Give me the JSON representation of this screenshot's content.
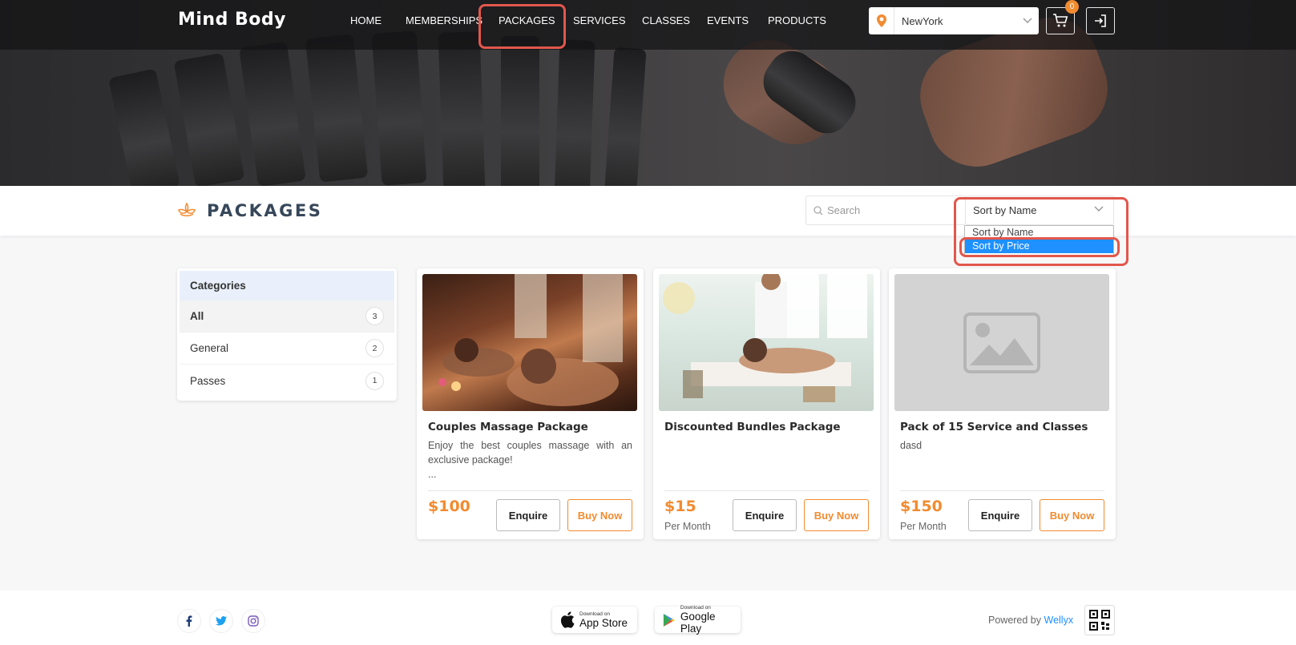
{
  "header": {
    "logo": "Mind Body",
    "nav": [
      {
        "label": "HOME"
      },
      {
        "label": "MEMBERSHIPS"
      },
      {
        "label": "PACKAGES"
      },
      {
        "label": "SERVICES"
      },
      {
        "label": "CLASSES"
      },
      {
        "label": "EVENTS"
      },
      {
        "label": "PRODUCTS"
      }
    ],
    "active_nav": "PACKAGES",
    "location": "NewYork",
    "cart_count": "0"
  },
  "page": {
    "title": "PACKAGES",
    "search_placeholder": "Search",
    "sort_selected": "Sort by Name",
    "sort_options": [
      "Sort by Name",
      "Sort by Price"
    ],
    "sort_highlighted": "Sort by Price"
  },
  "categories": {
    "heading": "Categories",
    "items": [
      {
        "label": "All",
        "count": "3",
        "active": true
      },
      {
        "label": "General",
        "count": "2",
        "active": false
      },
      {
        "label": "Passes",
        "count": "1",
        "active": false
      }
    ]
  },
  "packages": [
    {
      "name": "Couples Massage Package",
      "desc": "Enjoy the best couples massage with an exclusive package!",
      "ellipsis": "...",
      "price": "$100",
      "period": "",
      "enquire": "Enquire",
      "buy": "Buy Now",
      "image": "couples-massage-photo"
    },
    {
      "name": "Discounted Bundles Package",
      "desc": "",
      "ellipsis": "",
      "price": "$15",
      "period": "Per Month",
      "enquire": "Enquire",
      "buy": "Buy Now",
      "image": "spa-massage-photo"
    },
    {
      "name": "Pack of 15 Service and Classes",
      "desc": "dasd",
      "ellipsis": "",
      "price": "$150",
      "period": "Per Month",
      "enquire": "Enquire",
      "buy": "Buy Now",
      "image": "placeholder-image"
    }
  ],
  "footer": {
    "app_store_small": "Download on",
    "app_store_large": "App Store",
    "play_small": "Download on",
    "play_large": "Google Play",
    "powered_by": "Powered by",
    "powered_link": "Wellyx"
  },
  "colors": {
    "accent": "#f28b30",
    "highlight": "#e2574c",
    "link": "#1e90ff",
    "title": "#37475a"
  }
}
